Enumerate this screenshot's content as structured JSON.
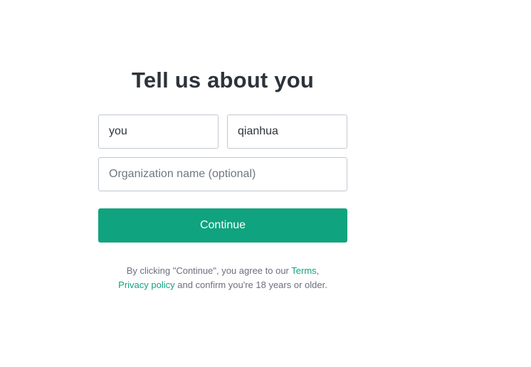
{
  "form": {
    "title": "Tell us about you",
    "first_name_value": "you",
    "last_name_value": "qianhua",
    "organization_placeholder": "Organization name (optional)",
    "continue_label": "Continue"
  },
  "legal": {
    "prefix": "By clicking \"Continue\", you agree to our ",
    "terms_link": "Terms",
    "separator": ",",
    "privacy_link": "Privacy policy",
    "suffix": " and confirm you're 18 years or older."
  },
  "colors": {
    "accent": "#10a37f",
    "border": "#c2c8d0",
    "heading": "#2d333a",
    "muted_text": "#6e6e80"
  }
}
